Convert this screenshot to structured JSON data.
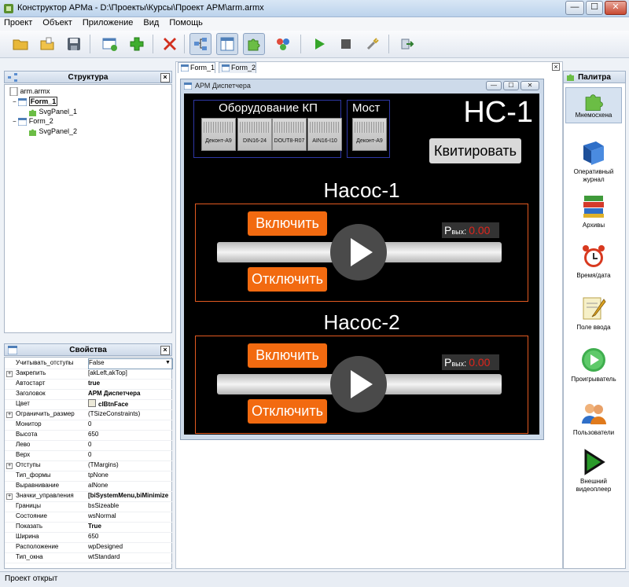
{
  "window": {
    "title": "Конструктор АРМа - D:\\Проекты\\Курсы\\Проект АРМ\\arm.armx",
    "buttons": {
      "minimize": "—",
      "maximize": "☐",
      "close": "✕"
    }
  },
  "menu": [
    "Проект",
    "Объект",
    "Приложение",
    "Вид",
    "Помощь"
  ],
  "toolbar": {
    "items": [
      "open-folder-icon",
      "open-file-icon",
      "save-icon",
      "new-form-icon",
      "add-icon",
      "delete-icon",
      "structure-icon",
      "layout-icon",
      "puzzle-icon",
      "components-icon",
      "run-icon",
      "stop-icon",
      "tools-icon",
      "export-icon"
    ]
  },
  "structure": {
    "title": "Структура",
    "items": [
      {
        "label": "arm.armx",
        "level": 0
      },
      {
        "label": "Form_1",
        "level": 1
      },
      {
        "label": "SvgPanel_1",
        "level": 2
      },
      {
        "label": "Form_2",
        "level": 1
      },
      {
        "label": "SvgPanel_2",
        "level": 2
      }
    ]
  },
  "properties": {
    "title": "Свойства",
    "rows": [
      {
        "name": "Учитывать_отступы",
        "value": "False",
        "expand": "",
        "bold": false,
        "combo": true
      },
      {
        "name": "Закрепить",
        "value": "[akLeft,akTop]",
        "expand": "+",
        "bold": false
      },
      {
        "name": "Автостарт",
        "value": "true",
        "expand": "",
        "bold": true
      },
      {
        "name": "Заголовок",
        "value": "АРМ Диспетчера",
        "expand": "",
        "bold": true
      },
      {
        "name": "Цвет",
        "value": "clBtnFace",
        "expand": "",
        "bold": true,
        "swatch": true
      },
      {
        "name": "Ограничить_размер",
        "value": "(TSizeConstraints)",
        "expand": "+",
        "bold": false
      },
      {
        "name": "Монитор",
        "value": "0",
        "expand": "",
        "bold": false
      },
      {
        "name": "Высота",
        "value": "650",
        "expand": "",
        "bold": false
      },
      {
        "name": "Лево",
        "value": "0",
        "expand": "",
        "bold": false
      },
      {
        "name": "Верх",
        "value": "0",
        "expand": "",
        "bold": false
      },
      {
        "name": "Отступы",
        "value": "(TMargins)",
        "expand": "+",
        "bold": false
      },
      {
        "name": "Тип_формы",
        "value": "tpNone",
        "expand": "",
        "bold": false
      },
      {
        "name": "Выравнивание",
        "value": "alNone",
        "expand": "",
        "bold": false
      },
      {
        "name": "Значки_управления",
        "value": "[biSystemMenu,biMinimize",
        "expand": "+",
        "bold": true
      },
      {
        "name": "Границы",
        "value": "bsSizeable",
        "expand": "",
        "bold": false
      },
      {
        "name": "Состояние",
        "value": "wsNormal",
        "expand": "",
        "bold": false
      },
      {
        "name": "Показать",
        "value": "True",
        "expand": "",
        "bold": true
      },
      {
        "name": "Ширина",
        "value": "650",
        "expand": "",
        "bold": false
      },
      {
        "name": "Расположение",
        "value": "wpDesigned",
        "expand": "",
        "bold": false
      },
      {
        "name": "Тип_окна",
        "value": "wtStandard",
        "expand": "",
        "bold": false
      }
    ]
  },
  "tabs": [
    "Form_1",
    "Form_2"
  ],
  "form": {
    "title": "АРМ Диспетчера",
    "equipment": {
      "title": "Оборудование КП",
      "modules": [
        "Деконт-А9",
        "DIN16-24",
        "DOUT8-R07",
        "AIN16-I10"
      ]
    },
    "bridge": {
      "title": "Мост",
      "modules": [
        "Деконт-А9"
      ]
    },
    "station": "НС-1",
    "ack_button": "Квитировать",
    "pumps": [
      {
        "title": "Насос-1",
        "on": "Включить",
        "off": "Отключить",
        "readout_label": "Р",
        "readout_sub": "вых",
        "readout_sep": ":",
        "readout_value": "0.00"
      },
      {
        "title": "Насос-2",
        "on": "Включить",
        "off": "Отключить",
        "readout_label": "Р",
        "readout_sub": "вых",
        "readout_sep": ":",
        "readout_value": "0.00"
      }
    ]
  },
  "palette": {
    "title": "Палитра",
    "items": [
      {
        "label": "Мнемосхена",
        "icon": "puzzle-icon"
      },
      {
        "label": "Оперативный журнал",
        "icon": "book-icon"
      },
      {
        "label": "Архивы",
        "icon": "books-icon"
      },
      {
        "label": "Время/дата",
        "icon": "alarm-clock-icon"
      },
      {
        "label": "Поле ввода",
        "icon": "input-field-icon"
      },
      {
        "label": "Проигрыватель",
        "icon": "player-icon"
      },
      {
        "label": "Пользователи",
        "icon": "users-icon"
      },
      {
        "label": "Внешний видеоплеер",
        "icon": "video-player-icon"
      }
    ]
  },
  "status": "Проект открыт",
  "colors": {
    "accent": "#f26a10",
    "frame": "#e35a21",
    "equipment_border": "#2e37a6",
    "readout_value": "#e0251c"
  }
}
